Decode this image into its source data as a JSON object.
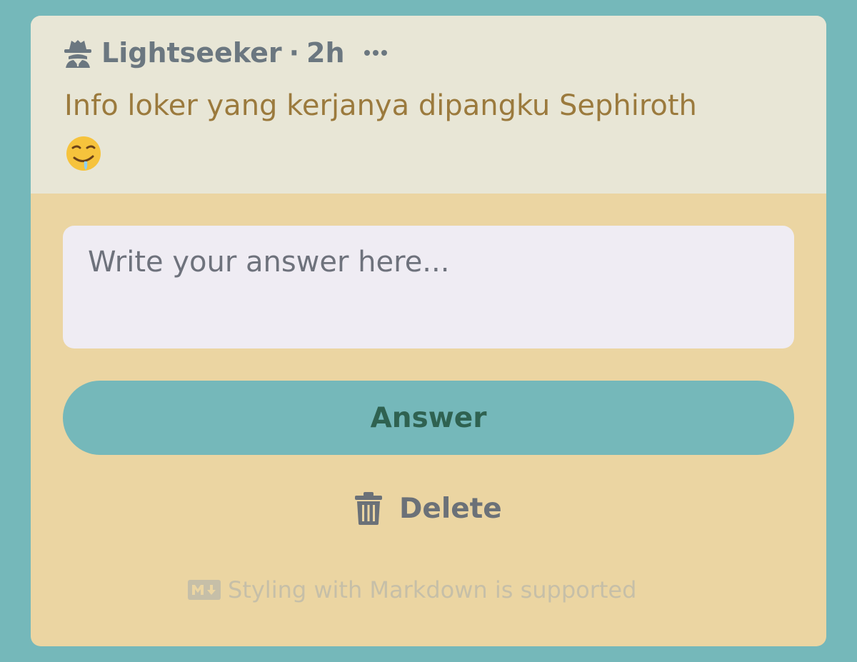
{
  "post": {
    "author": "Lightseeker",
    "separator": "·",
    "time": "2h",
    "question": "Info loker yang kerjanya dipangku Sephiroth",
    "emoji_icon": "drooling-face-icon"
  },
  "answer_form": {
    "placeholder": "Write your answer here...",
    "value": "",
    "submit_label": "Answer",
    "delete_label": "Delete",
    "markdown_note": "Styling with Markdown is supported"
  },
  "colors": {
    "background": "#75b8ba",
    "header_bg": "#e8e6d6",
    "card_bg": "#ebd5a2",
    "question_text": "#9b7a3d",
    "button_bg": "#75b8ba",
    "button_text": "#2f6251"
  }
}
